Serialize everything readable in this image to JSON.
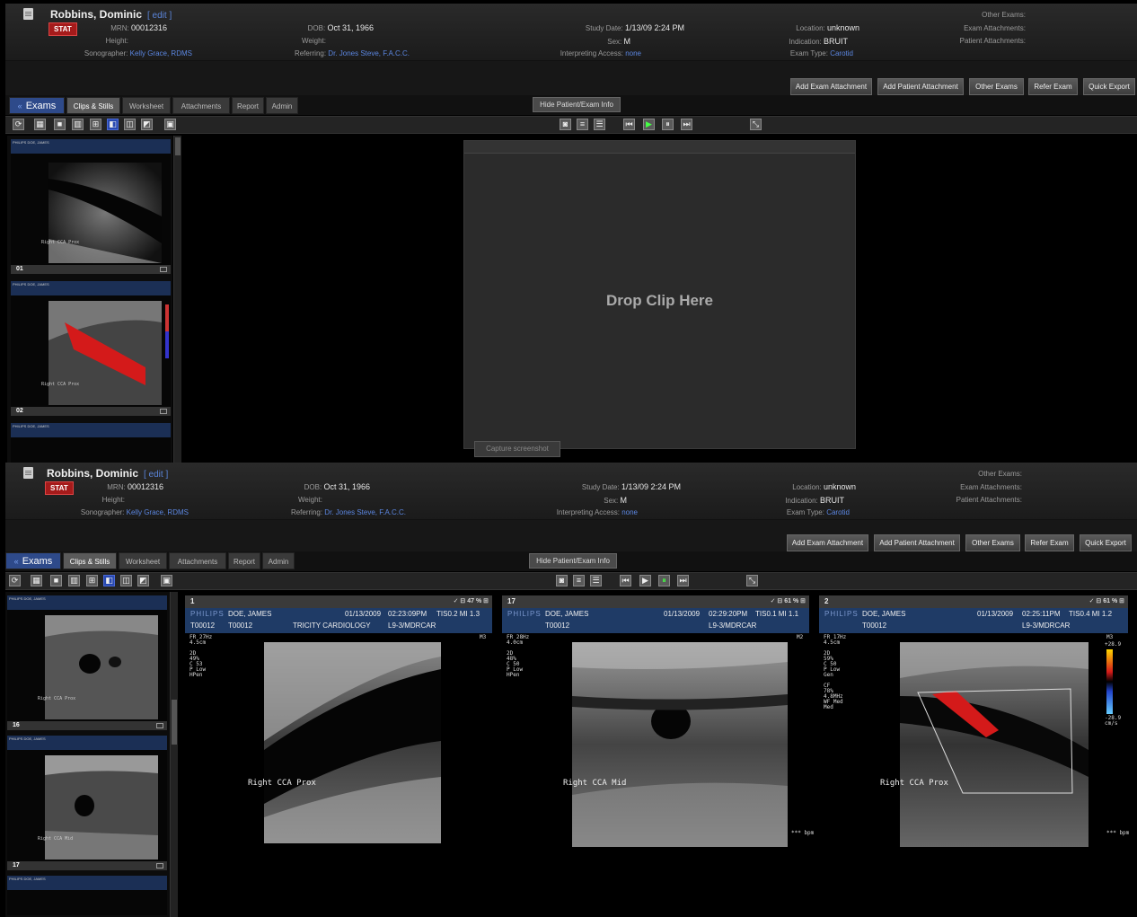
{
  "patient": {
    "name": "Robbins, Dominic",
    "edit": "[ edit ]",
    "stat": "STAT",
    "mrn_label": "MRN:",
    "mrn": "00012316",
    "height_label": "Height:",
    "sonographer_label": "Sonographer:",
    "sonographer": "Kelly Grace, RDMS",
    "dob_label": "DOB:",
    "dob": "Oct 31, 1966",
    "weight_label": "Weight:",
    "referring_label": "Referring:",
    "referring": "Dr. Jones Steve, F.A.C.C.",
    "study_date_label": "Study Date:",
    "study_date": "1/13/09 2:24 PM",
    "sex_label": "Sex:",
    "sex": "M",
    "interp_label": "Interpreting Access:",
    "interp": "none",
    "location_label": "Location:",
    "location": "unknown",
    "indication_label": "Indication:",
    "indication": "BRUIT",
    "exam_type_label": "Exam Type:",
    "exam_type": "Carotid",
    "other_exams_label": "Other Exams:",
    "exam_attach_label": "Exam Attachments:",
    "patient_attach_label": "Patient Attachments:"
  },
  "actions": {
    "add_exam_attachment": "Add Exam Attachment",
    "add_patient_attachment": "Add Patient Attachment",
    "other_exams": "Other Exams",
    "refer_exam": "Refer Exam",
    "quick_export": "Quick Export"
  },
  "tabs": {
    "exams_chevron": "«",
    "exams": "Exams",
    "clips": "Clips & Stills",
    "worksheet": "Worksheet",
    "attachments": "Attachments",
    "report": "Report",
    "admin": "Admin",
    "hide_info": "Hide Patient/Exam Info"
  },
  "dropzone": {
    "text": "Drop Clip Here",
    "capture": "Capture screenshot"
  },
  "thumbs_top": [
    {
      "num": "01",
      "name": "DOE, JAMES",
      "label": "Right  CCA  Prox"
    },
    {
      "num": "02",
      "name": "DOE, JAMES",
      "label": "Right  CCA  Prox"
    },
    {
      "num": "",
      "name": "DOE, JAMES",
      "label": ""
    }
  ],
  "thumbs_bottom": [
    {
      "num": "16",
      "name": "DOE, JAMES",
      "label": "Right  CCA  Prox"
    },
    {
      "num": "17",
      "name": "DOE, JAMES",
      "label": "Right  CCA  Mid"
    },
    {
      "num": "",
      "name": "DOE, JAMES",
      "label": ""
    }
  ],
  "viewers": [
    {
      "num": "1",
      "zoom": "✓ ⊟ 47 % ⊞",
      "brand": "PHILIPS",
      "name": "DOE, JAMES",
      "date": "01/13/2009",
      "time": "02:23:09PM",
      "ti": "TIS0.2  MI 1.3",
      "id": "T00012",
      "site": "TRICITY CARDIOLOGY",
      "probe": "L9-3/MDRCAR",
      "params": "FR 27Hz\n4.5cm\n\n2D\n49%\nC 53\nP Low\nHPen",
      "label": "Right  CCA  Prox",
      "mode": "M3",
      "bpm": ""
    },
    {
      "num": "17",
      "zoom": "✓ ⊟ 61 % ⊞",
      "brand": "PHILIPS",
      "name": "DOE, JAMES",
      "date": "01/13/2009",
      "time": "02:29:20PM",
      "ti": "TIS0.1  MI 1.1",
      "id": "T00012",
      "site": "",
      "probe": "L9-3/MDRCAR",
      "params": "FR 28Hz\n4.0cm\n\n2D\n48%\nC 50\nP Low\nHPen",
      "label": "Right  CCA  Mid",
      "mode": "M2",
      "bpm": "*** bpm"
    },
    {
      "num": "2",
      "zoom": "✓ ⊟ 61 % ⊞",
      "brand": "PHILIPS",
      "name": "DOE, JAMES",
      "date": "01/13/2009",
      "time": "02:25:11PM",
      "ti": "TIS0.4  MI 1.2",
      "id": "T00012",
      "site": "",
      "probe": "L9-3/MDRCAR",
      "params": "FR 17Hz\n4.5cm\n\n2D\n59%\nC 50\nP Low\nGen\n\nCF\n78%\n4.8MHz\nWF Med\nMed",
      "label": "Right  CCA  Prox",
      "mode": "M3",
      "bpm": "*** bpm",
      "scale_top": "+28.9",
      "scale_bottom": "-28.9\ncm/s"
    }
  ],
  "colors": {
    "accent": "#2e4a8a",
    "stat": "#a51b1b",
    "link": "#5b86e0",
    "doppler": "#d41a1a"
  }
}
